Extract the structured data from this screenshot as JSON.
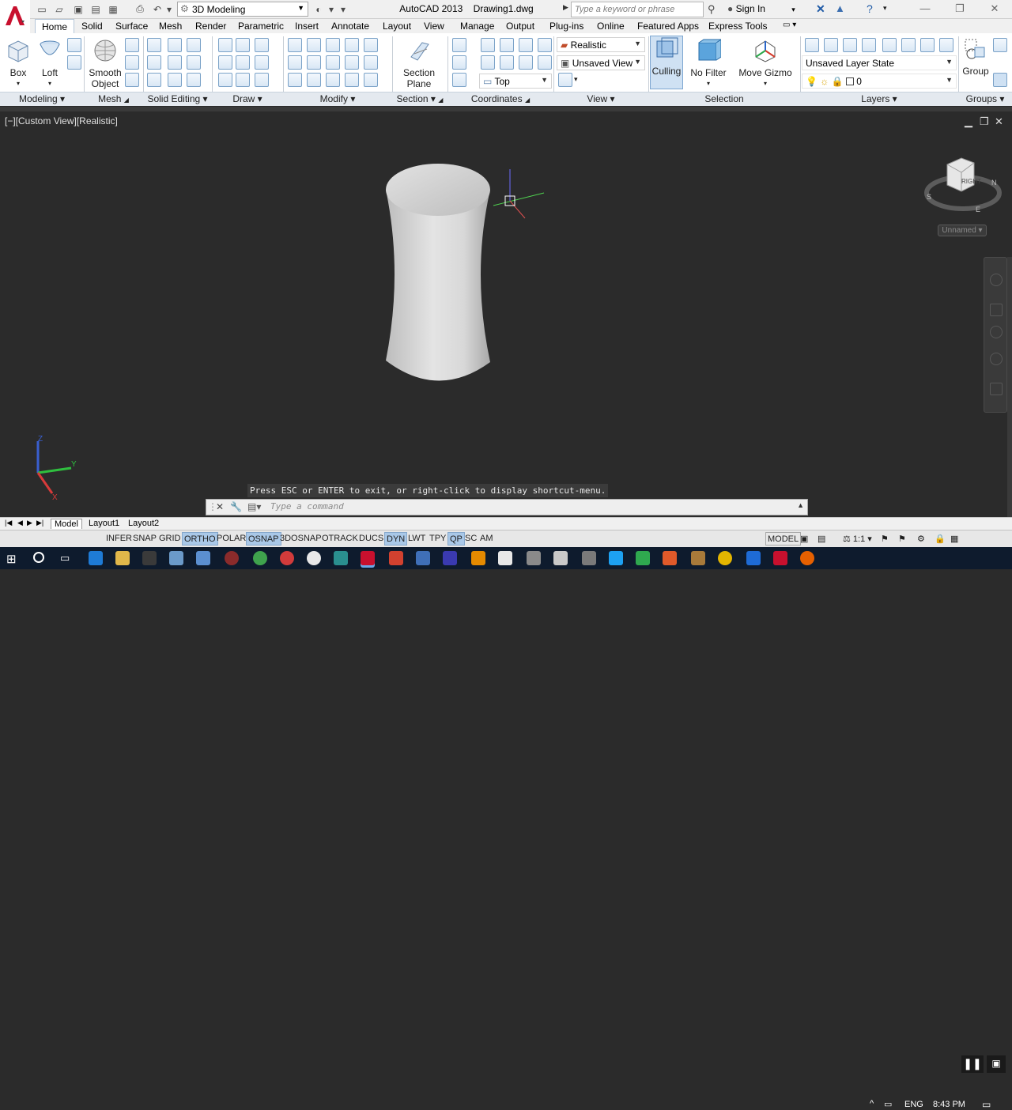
{
  "app": {
    "title": "AutoCAD 2013",
    "file": "Drawing1.dwg"
  },
  "quick_access": {
    "workspace": "3D Modeling"
  },
  "search": {
    "placeholder": "Type a keyword or phrase"
  },
  "account": {
    "sign_in": "Sign In"
  },
  "tabs": [
    {
      "label": "Home",
      "active": true
    },
    {
      "label": "Solid"
    },
    {
      "label": "Surface"
    },
    {
      "label": "Mesh"
    },
    {
      "label": "Render"
    },
    {
      "label": "Parametric"
    },
    {
      "label": "Insert"
    },
    {
      "label": "Annotate"
    },
    {
      "label": "Layout"
    },
    {
      "label": "View"
    },
    {
      "label": "Manage"
    },
    {
      "label": "Output"
    },
    {
      "label": "Plug-ins"
    },
    {
      "label": "Online"
    },
    {
      "label": "Featured Apps"
    },
    {
      "label": "Express Tools"
    }
  ],
  "ribbon": {
    "buttons": {
      "box": "Box",
      "loft": "Loft",
      "smooth_object_1": "Smooth",
      "smooth_object_2": "Object",
      "section_plane_1": "Section",
      "section_plane_2": "Plane",
      "culling": "Culling",
      "no_filter": "No Filter",
      "move_gizmo": "Move Gizmo",
      "group": "Group"
    },
    "combos": {
      "visual_style": "Realistic",
      "view": "Unsaved View",
      "ucs": "Top",
      "layer_state": "Unsaved Layer State",
      "layer": "0"
    },
    "panels": [
      "Modeling",
      "Mesh",
      "Solid Editing",
      "Draw",
      "Modify",
      "Section",
      "Coordinates",
      "View",
      "Selection",
      "Layers",
      "Groups"
    ]
  },
  "viewport": {
    "label": "[−][Custom View][Realistic]",
    "viewcube_face": "RIGHT",
    "compass": [
      "S",
      "E",
      "N"
    ],
    "ucs_name": "Unnamed",
    "axes": {
      "x": "X",
      "y": "Y",
      "z": "Z"
    }
  },
  "command": {
    "message": "Press ESC or ENTER to exit, or right-click to display shortcut-menu.",
    "placeholder": "Type a command"
  },
  "layouts": [
    {
      "label": "Model",
      "active": true
    },
    {
      "label": "Layout1"
    },
    {
      "label": "Layout2"
    }
  ],
  "status": {
    "toggles": [
      {
        "label": "INFER"
      },
      {
        "label": "SNAP"
      },
      {
        "label": "GRID"
      },
      {
        "label": "ORTHO",
        "on": true
      },
      {
        "label": "POLAR"
      },
      {
        "label": "OSNAP",
        "on": true
      },
      {
        "label": "3DOSNAP"
      },
      {
        "label": "OTRACK"
      },
      {
        "label": "DUCS"
      },
      {
        "label": "DYN",
        "on": true
      },
      {
        "label": "LWT"
      },
      {
        "label": "TPY"
      },
      {
        "label": "QP",
        "on": true
      },
      {
        "label": "SC"
      },
      {
        "label": "AM"
      }
    ],
    "space": "MODEL",
    "scale": "1:1"
  },
  "taskbar": {
    "language": "ENG",
    "time": "8:43 PM"
  },
  "colors": {
    "viewport_bg": "#2b2b2b",
    "ribbon_bg": "#ffffff",
    "toggle_on": "#a9c8e8",
    "taskbar": "#0e1b2d"
  }
}
